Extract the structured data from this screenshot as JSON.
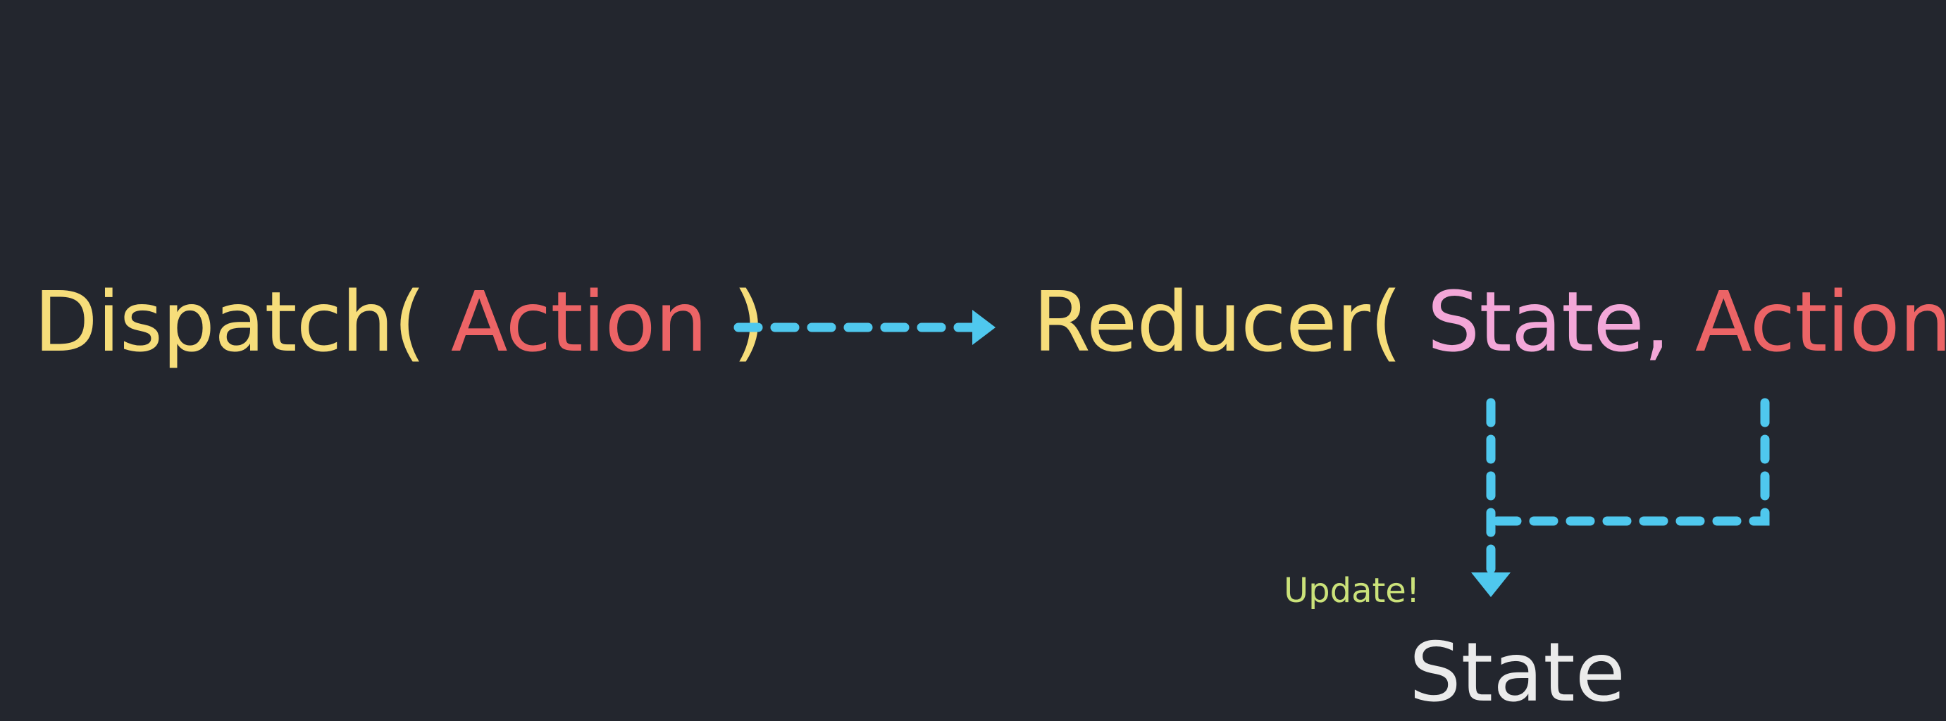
{
  "dispatch": {
    "func": "Dispatch(",
    "arg": "Action",
    "close": " )"
  },
  "reducer": {
    "func": "Reducer(",
    "arg1": "State",
    "sep": ",",
    "arg2": "Action",
    "close": " )"
  },
  "update_label": "Update!",
  "result": "State",
  "colors": {
    "background": "#23262e",
    "function": "#f6dd7a",
    "action": "#ec6466",
    "state": "#f3a7d8",
    "result": "#ebebeb",
    "update": "#cbe27a",
    "arrow": "#4fc8ee"
  }
}
